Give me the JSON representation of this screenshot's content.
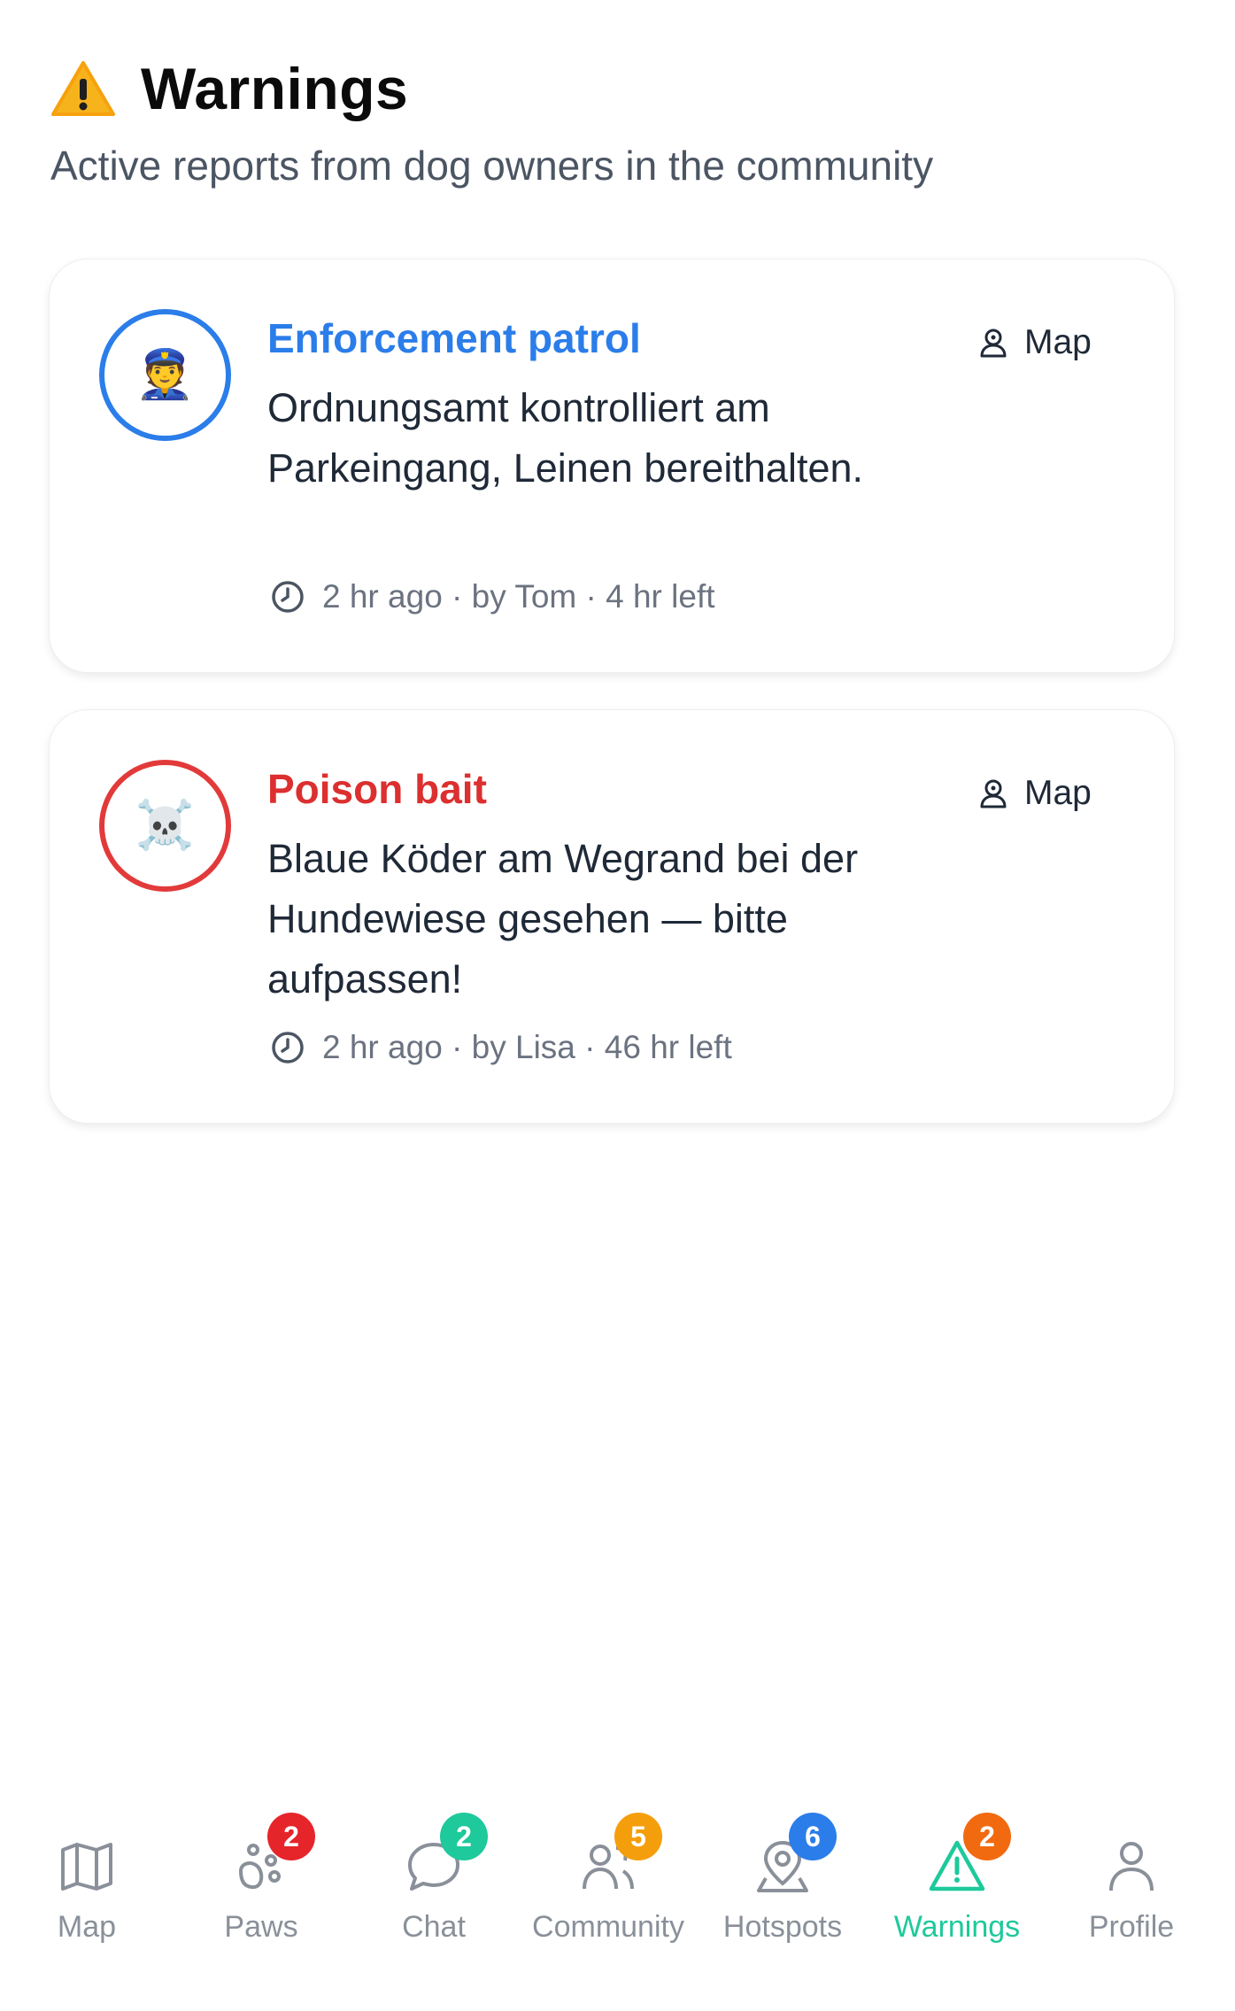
{
  "header": {
    "title": "Warnings",
    "subtitle": "Active reports from dog owners in the community",
    "icon": "warning-icon"
  },
  "warnings": [
    {
      "title": "Enforcement patrol",
      "description": "Ordnungsamt kontrolliert am Parkeingang, Leinen bereithalten.",
      "meta": "2 hr ago · by Tom · 4 hr left",
      "avatar": "👮",
      "avatar_icon": "police-officer-icon",
      "map_label": "Map",
      "color": "#2b7de9"
    },
    {
      "title": "Poison bait",
      "description": "Blaue Köder am Wegrand bei der Hundewiese gesehen — bitte aufpassen!",
      "meta": "2 hr ago · by Lisa · 46 hr left",
      "avatar": "☠️",
      "avatar_icon": "skull-crossbones-icon",
      "map_label": "Map",
      "color": "#dc2f2f"
    }
  ],
  "nav": {
    "active_color": "#1ec99b",
    "items": [
      {
        "label": "Map",
        "icon": "map-icon",
        "badge": null
      },
      {
        "label": "Paws",
        "icon": "paw-icon",
        "badge": "2",
        "badge_color": "#e5252a"
      },
      {
        "label": "Chat",
        "icon": "chat-bubble-icon",
        "badge": "2",
        "badge_color": "#1ec99b"
      },
      {
        "label": "Community",
        "icon": "users-icon",
        "badge": "5",
        "badge_color": "#f59e0b"
      },
      {
        "label": "Hotspots",
        "icon": "map-pin-icon",
        "badge": "6",
        "badge_color": "#2b7de9"
      },
      {
        "label": "Warnings",
        "icon": "warning-triangle-icon",
        "badge": "2",
        "badge_color": "#f26a0f",
        "active": true
      },
      {
        "label": "Profile",
        "icon": "user-icon",
        "badge": null
      }
    ]
  }
}
